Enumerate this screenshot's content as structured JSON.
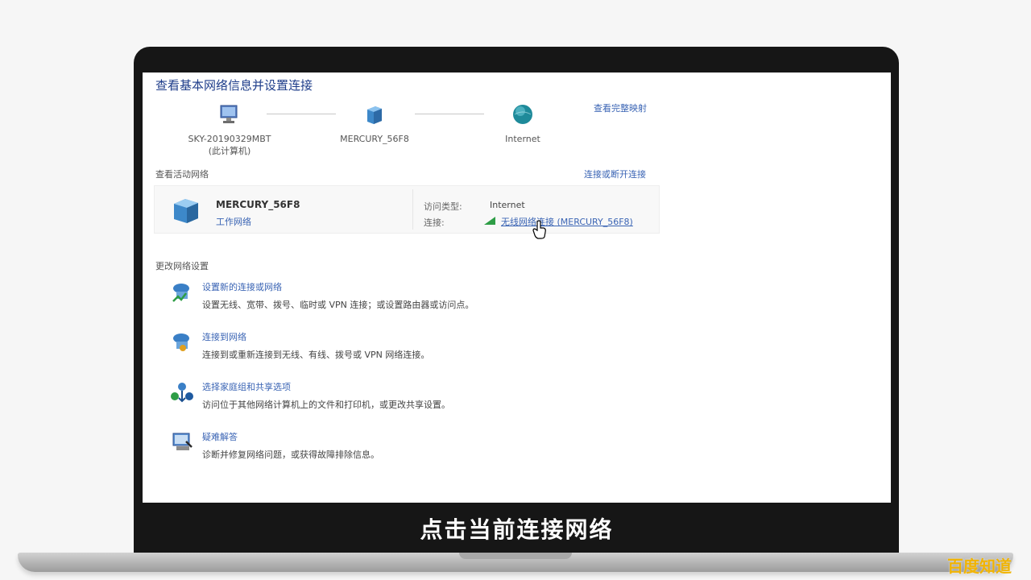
{
  "page": {
    "title": "查看基本网络信息并设置连接",
    "see_full_map": "查看完整映射"
  },
  "topology": {
    "computer": {
      "name": "SKY-20190329MBT",
      "sub": "(此计算机)",
      "icon": "computer-icon"
    },
    "router": {
      "name": "MERCURY_56F8",
      "icon": "network-icon"
    },
    "internet": {
      "name": "Internet",
      "icon": "globe-icon"
    }
  },
  "active_networks": {
    "label": "查看活动网络",
    "connect_disconnect": "连接或断开连接",
    "network_name": "MERCURY_56F8",
    "network_type": "工作网络",
    "access_type_label": "访问类型:",
    "access_type_value": "Internet",
    "connection_label": "连接:",
    "connection_link": "无线网络连接 (MERCURY_56F8)"
  },
  "settings": {
    "label": "更改网络设置",
    "tasks": [
      {
        "title": "设置新的连接或网络",
        "desc": "设置无线、宽带、拨号、临时或 VPN 连接；或设置路由器或访问点。",
        "icon": "new-connection-icon"
      },
      {
        "title": "连接到网络",
        "desc": "连接到或重新连接到无线、有线、拨号或 VPN 网络连接。",
        "icon": "connect-network-icon"
      },
      {
        "title": "选择家庭组和共享选项",
        "desc": "访问位于其他网络计算机上的文件和打印机，或更改共享设置。",
        "icon": "homegroup-icon"
      },
      {
        "title": "疑难解答",
        "desc": "诊断并修复网络问题，或获得故障排除信息。",
        "icon": "troubleshoot-icon"
      }
    ]
  },
  "subtitle": "点击当前连接网络",
  "watermark": "百度知道",
  "colors": {
    "link": "#3a64b4",
    "title": "#1e3d8a",
    "watermark": "#f1b300"
  }
}
